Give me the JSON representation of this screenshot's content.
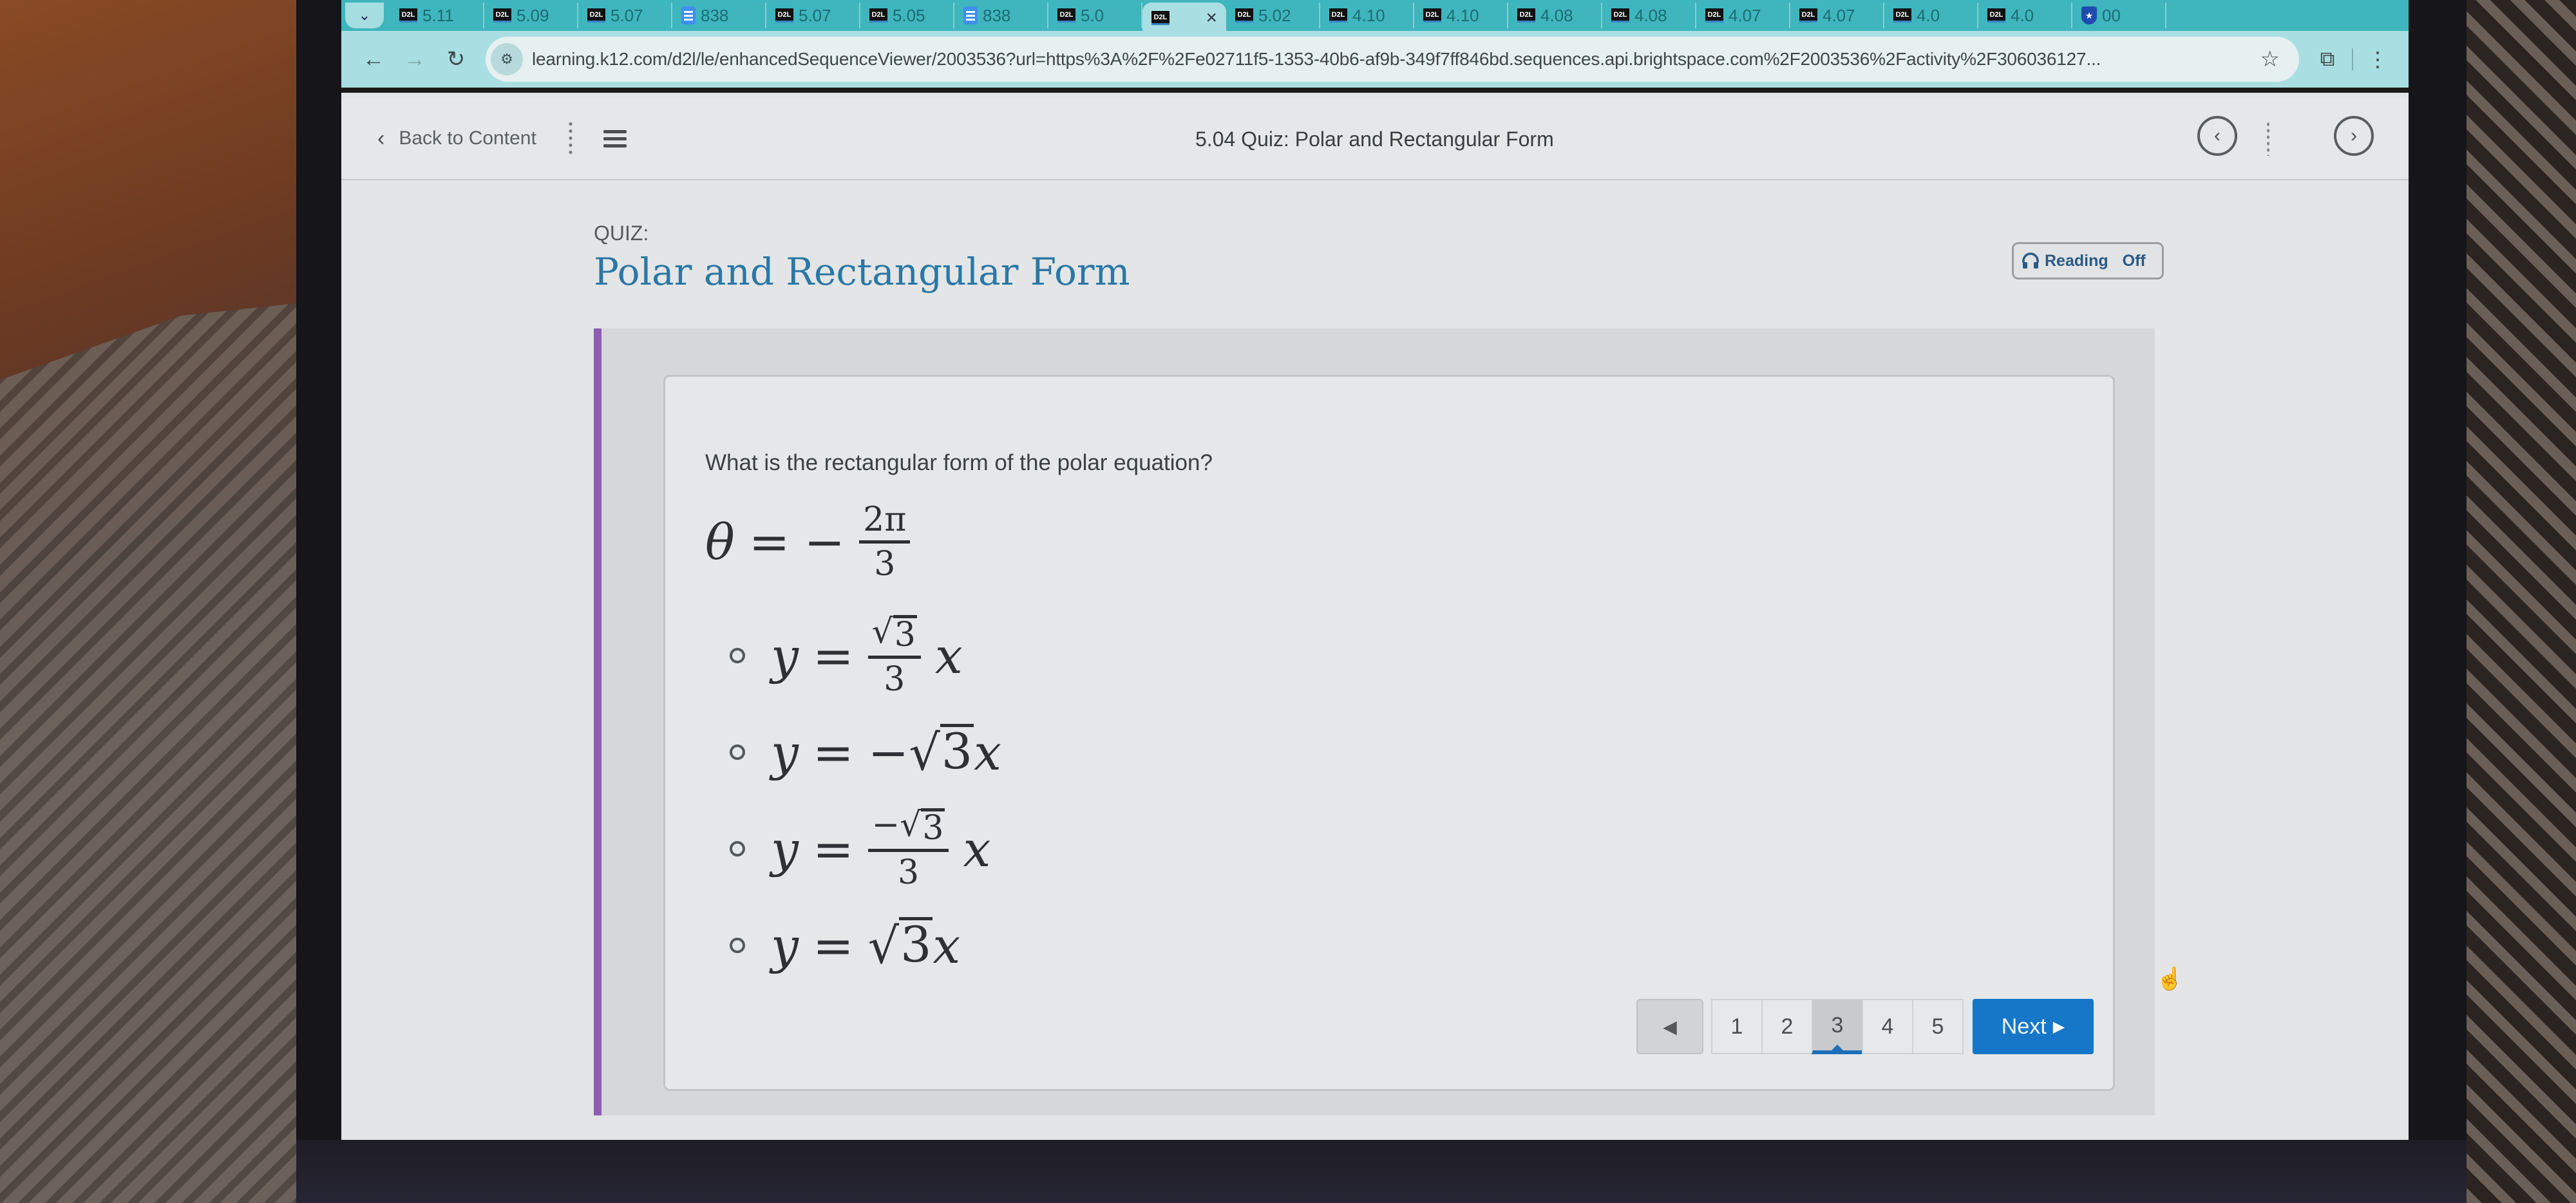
{
  "browser": {
    "tabs": [
      {
        "icon": "d2l",
        "label": "5.11"
      },
      {
        "icon": "d2l",
        "label": "5.09"
      },
      {
        "icon": "d2l",
        "label": "5.07"
      },
      {
        "icon": "doc",
        "label": "838"
      },
      {
        "icon": "d2l",
        "label": "5.07"
      },
      {
        "icon": "d2l",
        "label": "5.05"
      },
      {
        "icon": "doc",
        "label": "838"
      },
      {
        "icon": "d2l",
        "label": "5.0"
      },
      {
        "icon": "d2l",
        "label": "",
        "active": true,
        "close": "×"
      },
      {
        "icon": "d2l",
        "label": "5.02"
      },
      {
        "icon": "d2l",
        "label": "4.10"
      },
      {
        "icon": "d2l",
        "label": "4.10"
      },
      {
        "icon": "d2l",
        "label": "4.08"
      },
      {
        "icon": "d2l",
        "label": "4.08"
      },
      {
        "icon": "d2l",
        "label": "4.07"
      },
      {
        "icon": "d2l",
        "label": "4.07"
      },
      {
        "icon": "d2l",
        "label": "4.0"
      },
      {
        "icon": "d2l",
        "label": "4.0"
      },
      {
        "icon": "shield",
        "label": "00"
      }
    ],
    "url": "learning.k12.com/d2l/le/enhancedSequenceViewer/2003536?url=https%3A%2F%2Fe02711f5-1353-40b6-af9b-349f7ff846bd.sequences.api.brightspace.com%2F2003536%2Factivity%2F306036127..."
  },
  "header": {
    "back_label": "Back to Content",
    "title": "5.04 Quiz: Polar and Rectangular Form"
  },
  "quiz": {
    "label": "QUIZ:",
    "title": "Polar and Rectangular Form",
    "reading_label": "Reading",
    "reading_state": "Off",
    "accent_color": "#8e5db4",
    "title_color": "#2a78a6"
  },
  "question": {
    "text": "What is the rectangular form of the polar equation?",
    "equation": {
      "lhs": "θ",
      "sign": "−",
      "numerator": "2π",
      "denominator": "3"
    },
    "options": [
      {
        "lhs": "y",
        "form": "fraction",
        "numerator_sign": "",
        "radicand": "3",
        "denominator": "3",
        "var": "x"
      },
      {
        "lhs": "y",
        "form": "inline",
        "sign": "−",
        "radicand": "3",
        "var": "x"
      },
      {
        "lhs": "y",
        "form": "fraction",
        "numerator_sign": "−",
        "radicand": "3",
        "denominator": "3",
        "var": "x"
      },
      {
        "lhs": "y",
        "form": "inline",
        "sign": "",
        "radicand": "3",
        "var": "x"
      }
    ],
    "selected": null
  },
  "pager": {
    "pages": [
      "1",
      "2",
      "3",
      "4",
      "5"
    ],
    "current": "3",
    "next_label": "Next",
    "prev_icon": "◀",
    "next_icon": "▶"
  },
  "symbols": {
    "eq": "=",
    "sqrt": "√"
  }
}
